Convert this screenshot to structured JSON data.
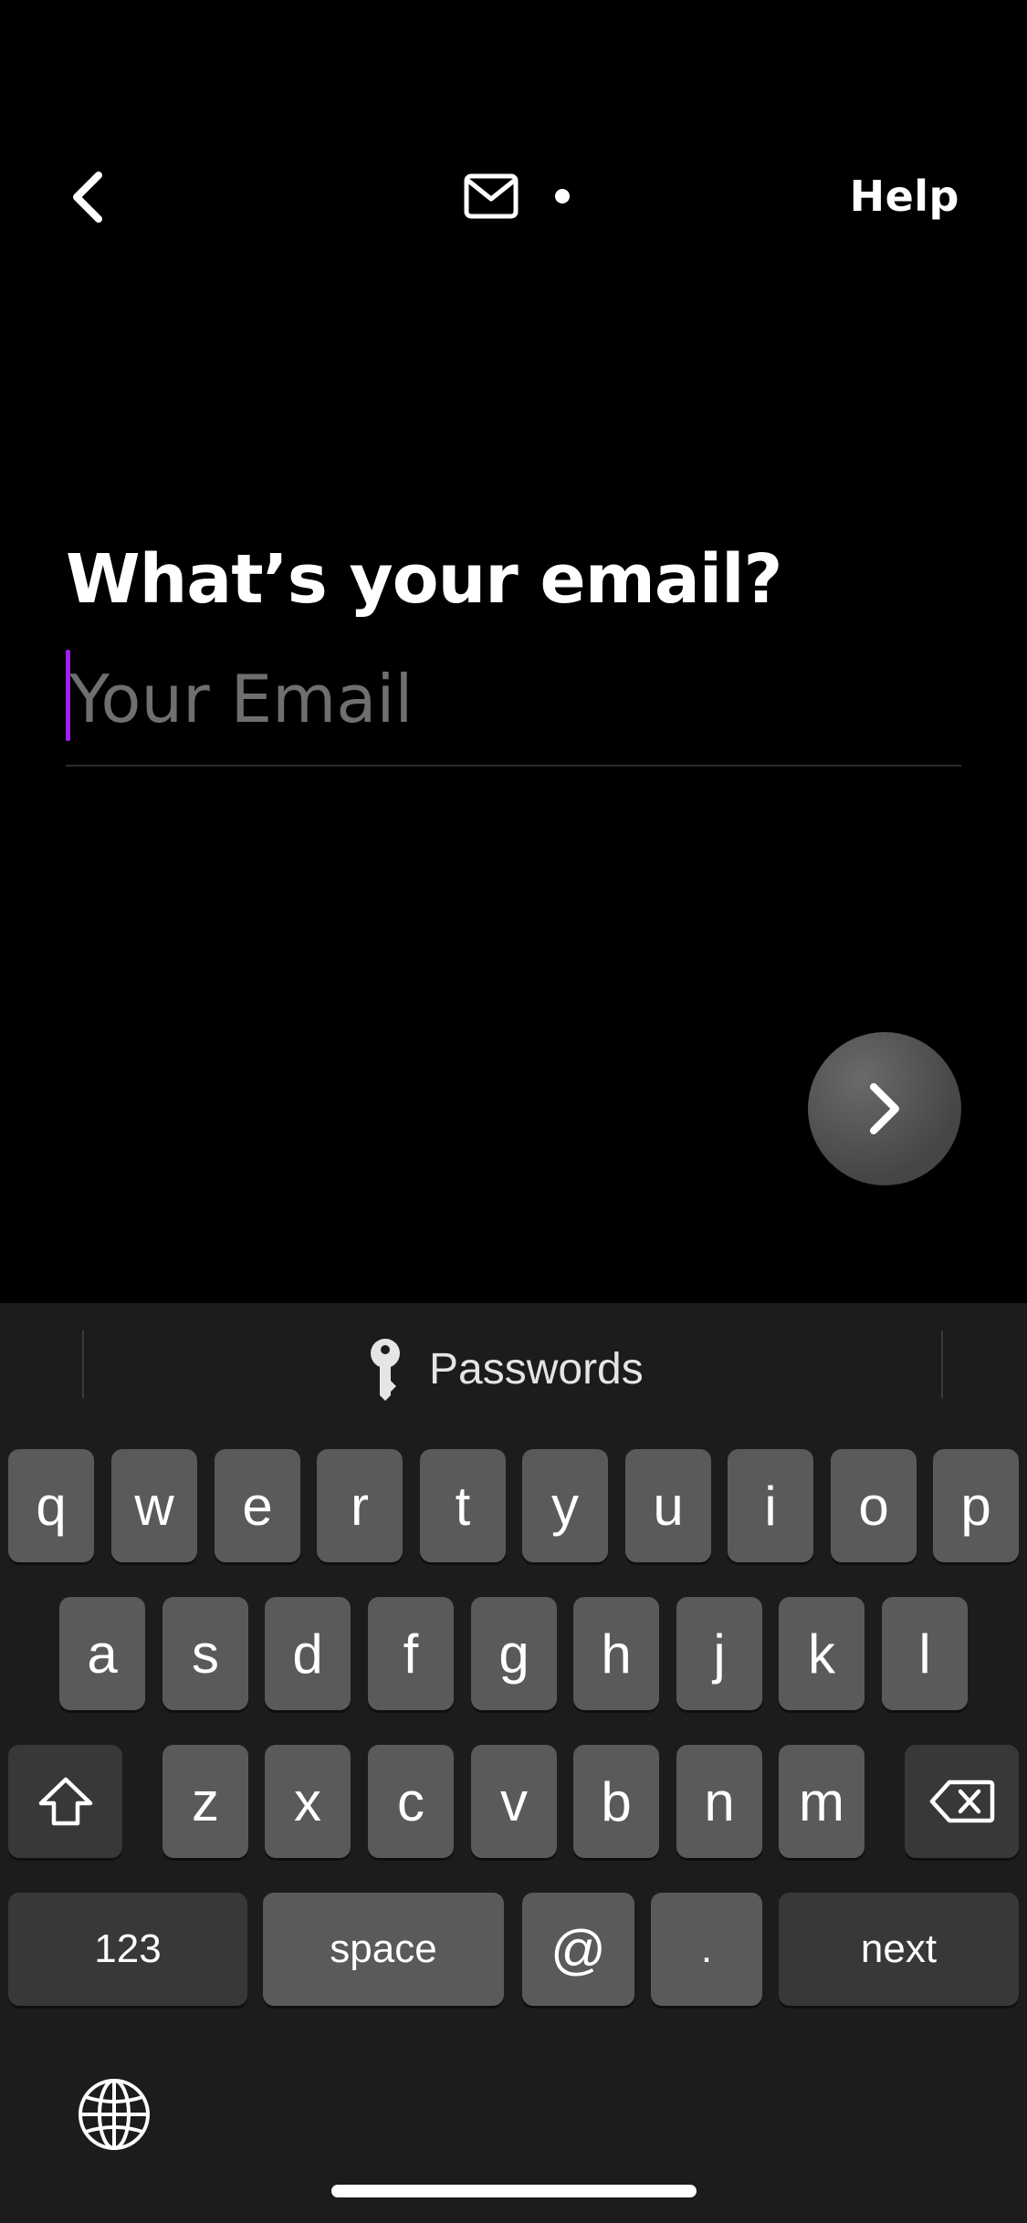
{
  "nav": {
    "back_icon": "chevron-left-icon",
    "progress_icon": "mail-icon",
    "help_label": "Help"
  },
  "main": {
    "title": "What’s your email?",
    "email_placeholder": "Your Email",
    "email_value": "",
    "caret_color": "#a020f0",
    "next_icon": "chevron-right-icon"
  },
  "keyboard": {
    "suggestion_label": "Passwords",
    "suggestion_icon": "key-icon",
    "row1": [
      "q",
      "w",
      "e",
      "r",
      "t",
      "y",
      "u",
      "i",
      "o",
      "p"
    ],
    "row2": [
      "a",
      "s",
      "d",
      "f",
      "g",
      "h",
      "j",
      "k",
      "l"
    ],
    "row3": [
      "z",
      "x",
      "c",
      "v",
      "b",
      "n",
      "m"
    ],
    "shift_icon": "shift-icon",
    "delete_icon": "backspace-icon",
    "numbers_label": "123",
    "space_label": "space",
    "at_label": "@",
    "dot_label": ".",
    "next_label": "next",
    "globe_icon": "globe-icon"
  }
}
